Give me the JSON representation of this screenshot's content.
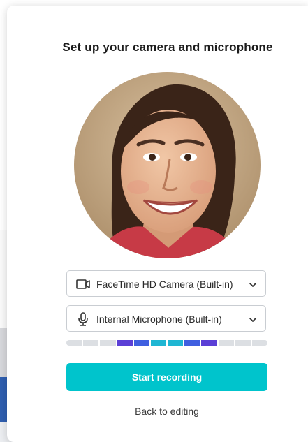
{
  "modal": {
    "title": "Set up your camera and microphone",
    "camera_select": {
      "selected": "FaceTime HD Camera (Built-in)",
      "icon": "video-camera-icon"
    },
    "microphone_select": {
      "selected": "Internal Microphone (Built-in)",
      "icon": "microphone-icon"
    },
    "audio_level": {
      "segments_total": 12,
      "active_segments": [
        3,
        4,
        5,
        6,
        7,
        8
      ],
      "segment_colors": [
        "#5b3fd6",
        "#3f5fe0",
        "#1fb6d3",
        "#1fb6d3",
        "#3f5fe0",
        "#5b3fd6"
      ],
      "inactive_color": "#dcdfe3"
    },
    "start_button_label": "Start recording",
    "back_link_label": "Back to editing"
  },
  "colors": {
    "accent": "#00c4cc",
    "brand_blue": "#2f5fb0"
  }
}
